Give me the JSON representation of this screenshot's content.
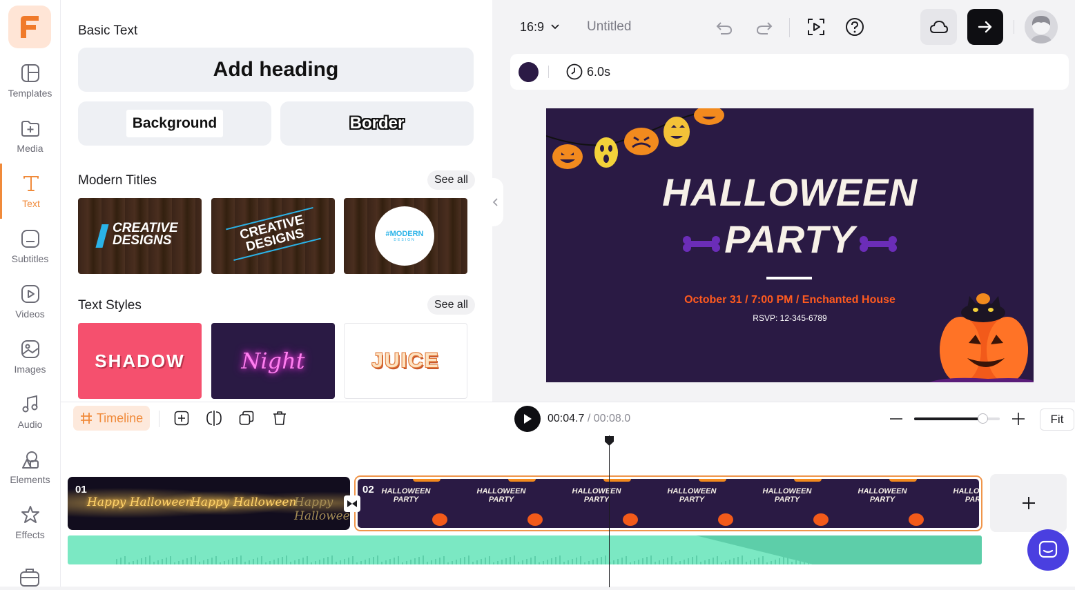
{
  "rail": {
    "items": [
      {
        "label": "Templates"
      },
      {
        "label": "Media"
      },
      {
        "label": "Text"
      },
      {
        "label": "Subtitles"
      },
      {
        "label": "Videos"
      },
      {
        "label": "Images"
      },
      {
        "label": "Audio"
      },
      {
        "label": "Elements"
      },
      {
        "label": "Effects"
      }
    ],
    "active": "Text"
  },
  "panel": {
    "basic_text": {
      "title": "Basic Text",
      "heading": "Add heading",
      "background": "Background",
      "border": "Border"
    },
    "modern_titles": {
      "title": "Modern Titles",
      "see_all": "See all",
      "thumbs": [
        {
          "line1": "CREATIVE",
          "line2": "DESIGNS"
        },
        {
          "line1": "CREATIVE",
          "line2": "DESIGNS"
        },
        {
          "line1": "#MODERN",
          "line2": "DESIGN"
        }
      ]
    },
    "text_styles": {
      "title": "Text Styles",
      "see_all": "See all",
      "thumbs": [
        "SHADOW",
        "Night",
        "JUICE"
      ]
    }
  },
  "topbar": {
    "aspect": "16:9",
    "project_name": "Untitled"
  },
  "scene_bar": {
    "duration": "6.0s",
    "color": "#2b1a45"
  },
  "canvas": {
    "title_line1": "HALLOWEEN",
    "title_line2": "PARTY",
    "details": "October 31 / 7:00 PM / Enchanted House",
    "rsvp": "RSVP: 12-345-6789",
    "bg_color": "#2a1a44",
    "accent": "#ff5a1f"
  },
  "timeline": {
    "tab_label": "Timeline",
    "current_time": "00:04.7",
    "total_time": "/ 00:08.0",
    "fit_label": "Fit",
    "zoom_level": 0.8,
    "clips": [
      {
        "index": "01",
        "label": "Happy Halloween"
      },
      {
        "index": "02",
        "label": "HALLOWEEN PARTY"
      }
    ],
    "frame_title": "HALLOWEEN",
    "frame_title2": "PARTY"
  },
  "colors": {
    "accent": "#f08a3a",
    "selected_clip": "#f0954a",
    "audio_track": "#7be8c3",
    "chat_button": "#4a3fe0"
  }
}
